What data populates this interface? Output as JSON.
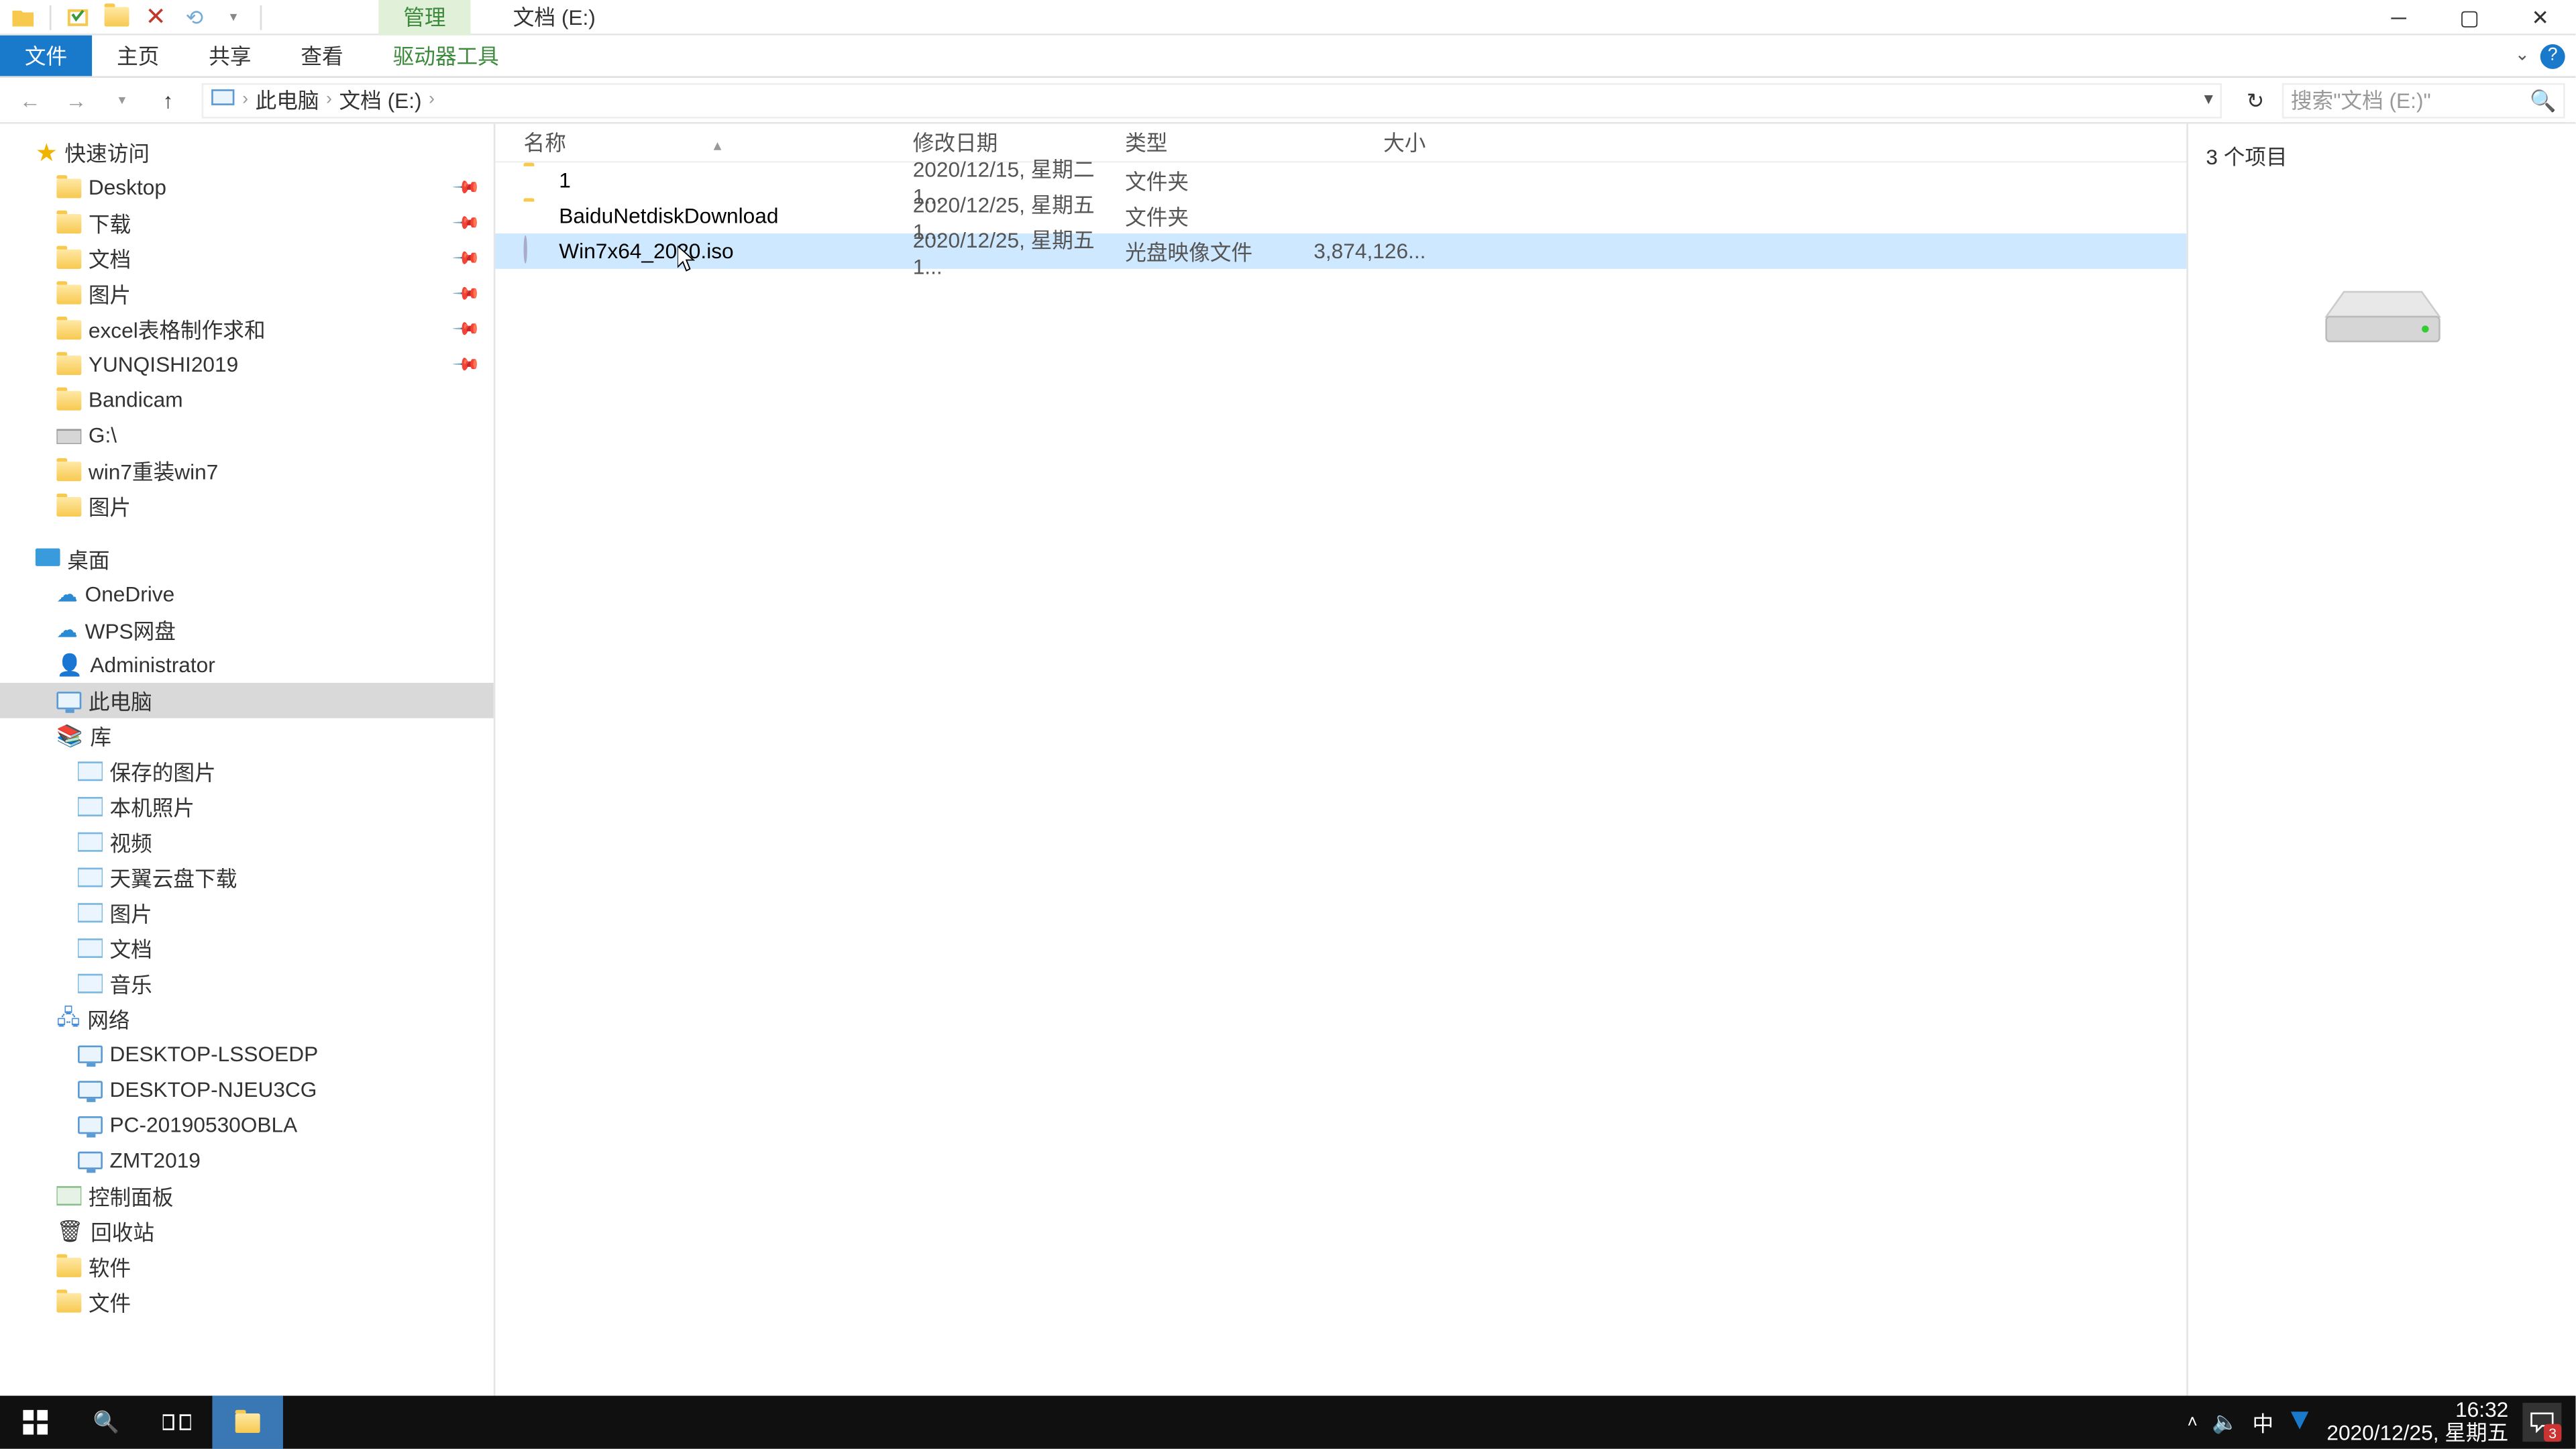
{
  "title": "文档 (E:)",
  "qat": {
    "manage_tab": "管理"
  },
  "ribbon": {
    "file": "文件",
    "tabs": [
      "主页",
      "共享",
      "查看"
    ],
    "context_tab": "驱动器工具"
  },
  "nav": {
    "breadcrumbs": [
      "此电脑",
      "文档 (E:)"
    ],
    "refresh": "↻"
  },
  "search": {
    "placeholder": "搜索\"文档 (E:)\""
  },
  "tree": {
    "quick_access": "快速访问",
    "pinned": [
      {
        "name": "Desktop",
        "icon": "desktop"
      },
      {
        "name": "下载",
        "icon": "download"
      },
      {
        "name": "文档",
        "icon": "doc"
      },
      {
        "name": "图片",
        "icon": "pic"
      },
      {
        "name": "excel表格制作求和",
        "icon": "folder"
      },
      {
        "name": "YUNQISHI2019",
        "icon": "folder"
      }
    ],
    "recent": [
      {
        "name": "Bandicam",
        "icon": "folder"
      },
      {
        "name": "G:\\",
        "icon": "drive"
      },
      {
        "name": "win7重装win7",
        "icon": "folder"
      },
      {
        "name": "图片",
        "icon": "folder"
      }
    ],
    "desktop": "桌面",
    "desktop_items": [
      {
        "name": "OneDrive",
        "icon": "onedrive"
      },
      {
        "name": "WPS网盘",
        "icon": "wps"
      },
      {
        "name": "Administrator",
        "icon": "user"
      },
      {
        "name": "此电脑",
        "icon": "pc",
        "selected": true
      },
      {
        "name": "库",
        "icon": "lib"
      }
    ],
    "libraries": [
      {
        "name": "保存的图片"
      },
      {
        "name": "本机照片"
      },
      {
        "name": "视频"
      },
      {
        "name": "天翼云盘下载"
      },
      {
        "name": "图片"
      },
      {
        "name": "文档"
      },
      {
        "name": "音乐"
      }
    ],
    "network": "网络",
    "network_items": [
      {
        "name": "DESKTOP-LSSOEDP"
      },
      {
        "name": "DESKTOP-NJEU3CG"
      },
      {
        "name": "PC-20190530OBLA"
      },
      {
        "name": "ZMT2019"
      }
    ],
    "misc": [
      {
        "name": "控制面板",
        "icon": "cpanel"
      },
      {
        "name": "回收站",
        "icon": "recycle"
      },
      {
        "name": "软件",
        "icon": "folder"
      },
      {
        "name": "文件",
        "icon": "folder"
      }
    ]
  },
  "columns": {
    "name": "名称",
    "date": "修改日期",
    "type": "类型",
    "size": "大小"
  },
  "files": [
    {
      "name": "1",
      "date": "2020/12/15, 星期二 1...",
      "type": "文件夹",
      "size": "",
      "icon": "folder"
    },
    {
      "name": "BaiduNetdiskDownload",
      "date": "2020/12/25, 星期五 1...",
      "type": "文件夹",
      "size": "",
      "icon": "folder"
    },
    {
      "name": "Win7x64_2020.iso",
      "date": "2020/12/25, 星期五 1...",
      "type": "光盘映像文件",
      "size": "3,874,126...",
      "icon": "disc",
      "selected": true
    }
  ],
  "preview": {
    "count": "3 个项目"
  },
  "status": {
    "text": "3 个项目"
  },
  "taskbar": {
    "clock_time": "16:32",
    "clock_date": "2020/12/25, 星期五",
    "ime": "中",
    "notifications": "3"
  }
}
